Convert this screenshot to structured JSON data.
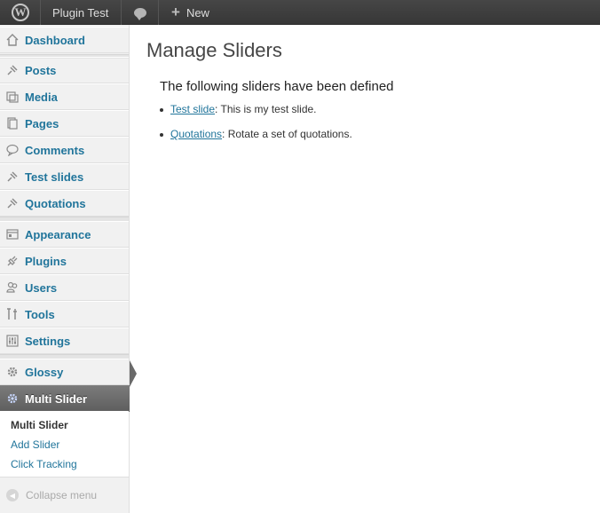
{
  "adminbar": {
    "site_name": "Plugin Test",
    "new_label": "New",
    "plus_glyph": "+"
  },
  "sidebar": {
    "items": [
      {
        "label": "Dashboard",
        "icon": "dashboard-icon"
      },
      {
        "label": "Posts",
        "icon": "pin-icon"
      },
      {
        "label": "Media",
        "icon": "media-icon"
      },
      {
        "label": "Pages",
        "icon": "pages-icon"
      },
      {
        "label": "Comments",
        "icon": "comments-icon"
      },
      {
        "label": "Test slides",
        "icon": "pin-icon"
      },
      {
        "label": "Quotations",
        "icon": "pin-icon"
      },
      {
        "label": "Appearance",
        "icon": "appearance-icon"
      },
      {
        "label": "Plugins",
        "icon": "plugins-icon"
      },
      {
        "label": "Users",
        "icon": "users-icon"
      },
      {
        "label": "Tools",
        "icon": "tools-icon"
      },
      {
        "label": "Settings",
        "icon": "settings-icon"
      },
      {
        "label": "Glossy",
        "icon": "gear-icon"
      },
      {
        "label": "Multi Slider",
        "icon": "gear-icon",
        "active": true
      }
    ],
    "submenu": [
      {
        "label": "Multi Slider",
        "current": true
      },
      {
        "label": "Add Slider"
      },
      {
        "label": "Click Tracking"
      }
    ],
    "collapse_label": "Collapse menu"
  },
  "main": {
    "title": "Manage Sliders",
    "subheading": "The following sliders have been defined",
    "sliders": [
      {
        "name": "Test slide",
        "description": ": This is my test slide."
      },
      {
        "name": "Quotations",
        "description": ": Rotate a set of quotations."
      }
    ]
  },
  "colors": {
    "link": "#21759b",
    "adminbar": "#464646",
    "active_menu": "#6a6a6a"
  }
}
